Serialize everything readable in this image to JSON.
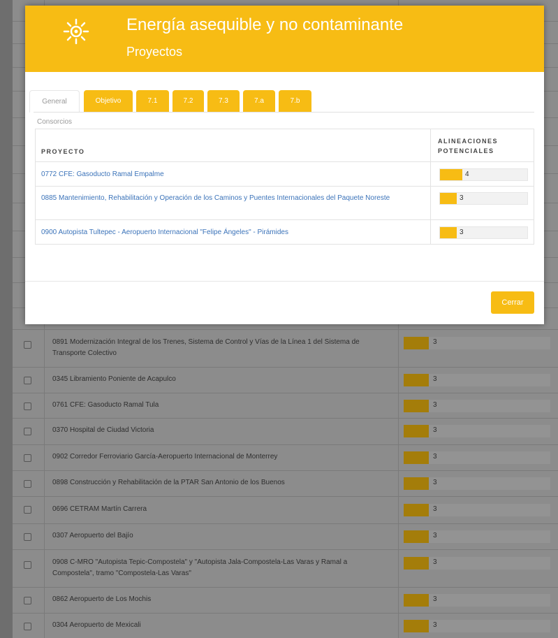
{
  "modal": {
    "title": "Energía asequible y no contaminante",
    "subtitle": "Proyectos",
    "icon": "sun-icon",
    "accent_color": "#f7bc14",
    "tabs": [
      {
        "label": "General",
        "active": true
      },
      {
        "label": "Objetivo",
        "active": false
      },
      {
        "label": "7.1",
        "active": false
      },
      {
        "label": "7.2",
        "active": false
      },
      {
        "label": "7.3",
        "active": false
      },
      {
        "label": "7.a",
        "active": false
      },
      {
        "label": "7.b",
        "active": false
      }
    ],
    "section_label": "Consorcios",
    "table": {
      "col_project": "PROYECTO",
      "col_alignments": "ALINEACIONES POTENCIALES",
      "rows": [
        {
          "project": "0772 CFE: Gasoducto Ramal Empalme",
          "count": "4"
        },
        {
          "project": "0885 Mantenimiento, Rehabilitación y Operación de los Caminos y Puentes Internacionales del Paquete Noreste",
          "count": "3"
        },
        {
          "project": "0900 Autopista Tultepec - Aeropuerto Internacional \"Felipe Ángeles\" - Pirámides",
          "count": "3"
        }
      ]
    },
    "close_label": "Cerrar"
  },
  "background_list": {
    "rows": [
      {
        "project": "0891 Modernización Integral de los Trenes, Sistema de Control y Vías de la Línea 1 del Sistema de Transporte Colectivo",
        "count": "3"
      },
      {
        "project": "0345 Libramiento Poniente de Acapulco",
        "count": "3"
      },
      {
        "project": "0761 CFE: Gasoducto Ramal Tula",
        "count": "3"
      },
      {
        "project": "0370 Hospital de Ciudad Victoria",
        "count": "3"
      },
      {
        "project": "0902 Corredor Ferroviario García-Aeropuerto Internacional de Monterrey",
        "count": "3"
      },
      {
        "project": "0898 Construcción y Rehabilitación de la PTAR San Antonio de los Buenos",
        "count": "3"
      },
      {
        "project": "0696 CETRAM Martín Carrera",
        "count": "3"
      },
      {
        "project": "0307 Aeropuerto del Bajío",
        "count": "3"
      },
      {
        "project": "0908 C-MRO \"Autopista Tepic-Compostela\" y \"Autopista Jala-Compostela-Las Varas y Ramal a Compostela\", tramo \"Compostela-Las Varas\"",
        "count": "3"
      },
      {
        "project": "0862 Aeropuerto de Los Mochis",
        "count": "3"
      },
      {
        "project": "0304 Aeropuerto de Mexicali",
        "count": "3"
      }
    ]
  }
}
